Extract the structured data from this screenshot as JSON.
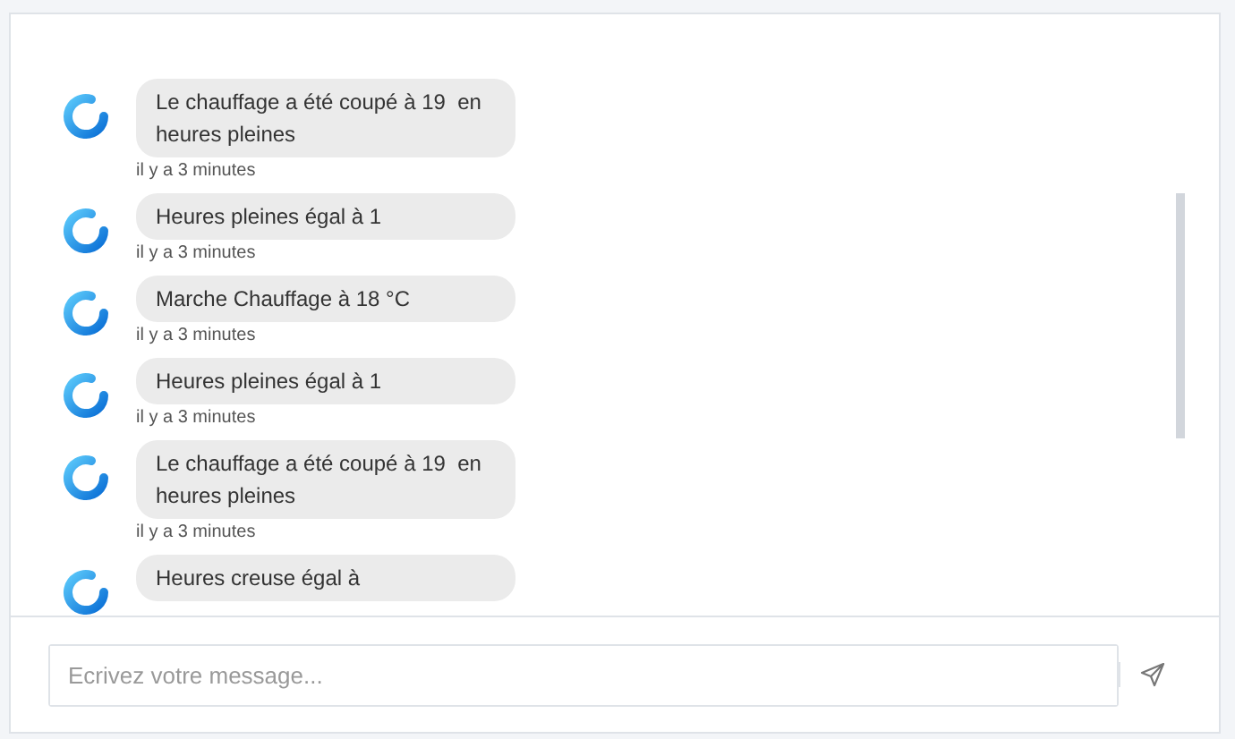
{
  "messages": [
    {
      "text": "Le chauffage a été coupé à 19  en heures pleines",
      "time": "il y a 3 minutes"
    },
    {
      "text": "Heures pleines égal à 1",
      "time": "il y a 3 minutes"
    },
    {
      "text": "Marche Chauffage à 18 °C",
      "time": "il y a 3 minutes"
    },
    {
      "text": "Heures pleines égal à 1",
      "time": "il y a 3 minutes"
    },
    {
      "text": "Le chauffage a été coupé à 19  en heures pleines",
      "time": "il y a 3 minutes"
    },
    {
      "text": "Heures creuse égal à"
    }
  ],
  "composer": {
    "placeholder": "Ecrivez votre message..."
  }
}
